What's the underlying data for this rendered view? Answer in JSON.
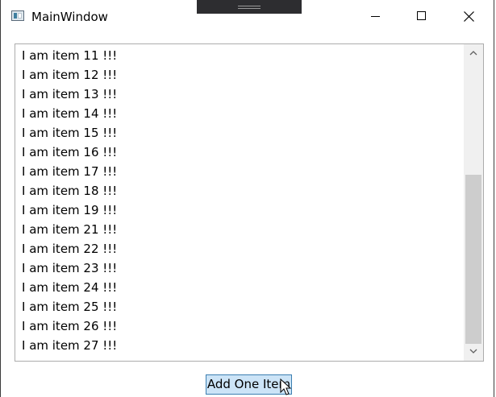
{
  "window": {
    "title": "MainWindow",
    "icon": "app-window-icon"
  },
  "caption_buttons": {
    "minimize_icon": "minimize-icon",
    "maximize_icon": "maximize-icon",
    "close_icon": "close-icon"
  },
  "list": {
    "items": [
      "I am item 11 !!!",
      "I am item 12 !!!",
      "I am item 13 !!!",
      "I am item 14 !!!",
      "I am item 15 !!!",
      "I am item 16 !!!",
      "I am item 17 !!!",
      "I am item 18 !!!",
      "I am item 19 !!!",
      "I am item 21 !!!",
      "I am item 22 !!!",
      "I am item 23 !!!",
      "I am item 24 !!!",
      "I am item 25 !!!",
      "I am item 26 !!!",
      "I am item 27 !!!"
    ]
  },
  "add_button": {
    "label": "Add One Item"
  },
  "colors": {
    "button_background": "#cce4f7",
    "button_border": "#3c7fb1",
    "scroll_thumb": "#cdcdcd",
    "scroll_track": "#f0f0f0"
  }
}
